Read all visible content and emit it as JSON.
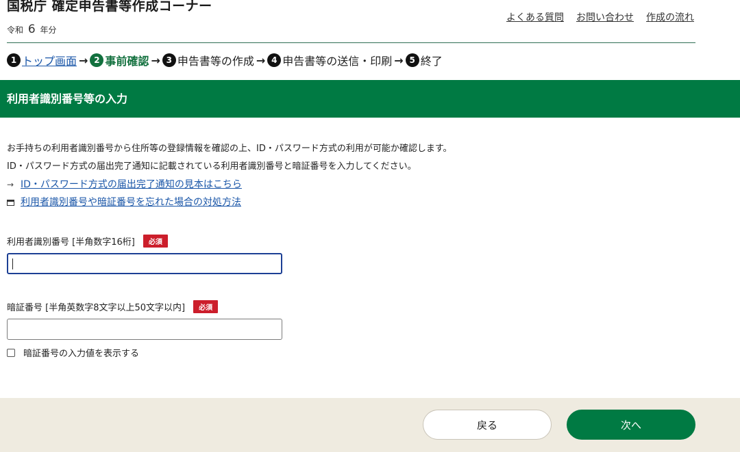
{
  "header": {
    "title": "国税庁 確定申告書等作成コーナー",
    "year_prefix": "令和",
    "year_number": "6",
    "year_suffix": "年分",
    "links": [
      "よくある質問",
      "お問い合わせ",
      "作成の流れ"
    ]
  },
  "steps": [
    {
      "num": "1",
      "label": "トップ画面"
    },
    {
      "num": "2",
      "label": "事前確認"
    },
    {
      "num": "3",
      "label": "申告書等の作成"
    },
    {
      "num": "4",
      "label": "申告書等の送信・印刷"
    },
    {
      "num": "5",
      "label": "終了"
    }
  ],
  "banner": {
    "title": "利用者識別番号等の入力"
  },
  "description": {
    "line1": "お手持ちの利用者識別番号から住所等の登録情報を確認の上、ID・パスワード方式の利用が可能か確認します。",
    "line2": "ID・パスワード方式の届出完了通知に記載されている利用者識別番号と暗証番号を入力してください。",
    "link1": "ID・パスワード方式の届出完了通知の見本はこちら",
    "link2": "利用者識別番号や暗証番号を忘れた場合の対処方法"
  },
  "form": {
    "user_id": {
      "label": "利用者識別番号 [半角数字16桁]",
      "required": "必須",
      "value": ""
    },
    "pin": {
      "label": "暗証番号 [半角英数字8文字以上50文字以内]",
      "required": "必須",
      "value": ""
    },
    "show_pin_label": "暗証番号の入力値を表示する"
  },
  "footer": {
    "back_label": "戻る",
    "next_label": "次へ"
  },
  "colors": {
    "primary_green": "#007a43",
    "required_red": "#cc1e2b",
    "link_blue": "#1a56a8",
    "footer_bg": "#efebe0"
  }
}
